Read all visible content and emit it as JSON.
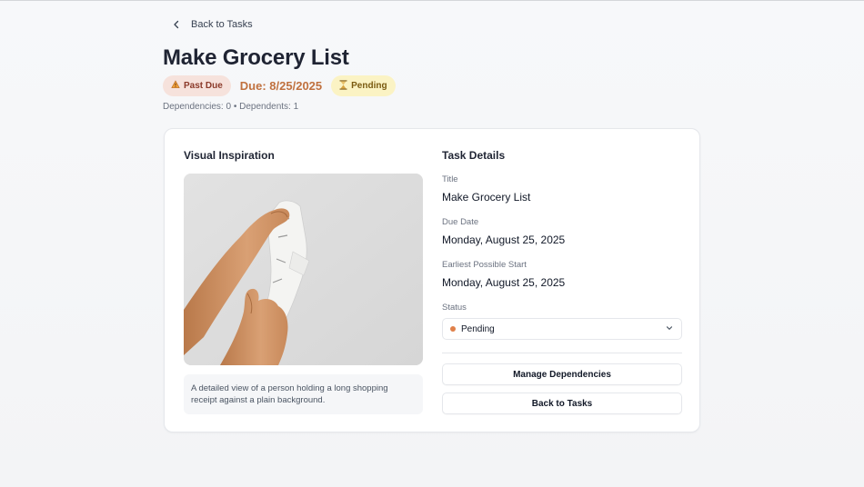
{
  "header": {
    "back_label": "Back to Tasks",
    "title": "Make Grocery List",
    "past_due_label": "Past Due",
    "due_text": "Due: 8/25/2025",
    "pending_label": "Pending",
    "dependencies_text": "Dependencies: 0 • Dependents: 1"
  },
  "inspiration": {
    "heading": "Visual Inspiration",
    "caption": "A detailed view of a person holding a long shopping receipt against a plain background."
  },
  "details": {
    "heading": "Task Details",
    "title_label": "Title",
    "title_value": "Make Grocery List",
    "due_label": "Due Date",
    "due_value": "Monday, August 25, 2025",
    "start_label": "Earliest Possible Start",
    "start_value": "Monday, August 25, 2025",
    "status_label": "Status",
    "status_value": "Pending"
  },
  "actions": {
    "manage_label": "Manage Dependencies",
    "back_label": "Back to Tasks"
  },
  "colors": {
    "accent_due": "#c0713f",
    "past_due_bg": "#f6e2dc",
    "pending_bg": "#fbf3c4",
    "status_dot": "#e0804a"
  },
  "icons": {
    "back": "chevron-left-icon",
    "past_due": "warning-icon",
    "pending": "hourglass-icon",
    "select": "chevron-down-icon"
  }
}
